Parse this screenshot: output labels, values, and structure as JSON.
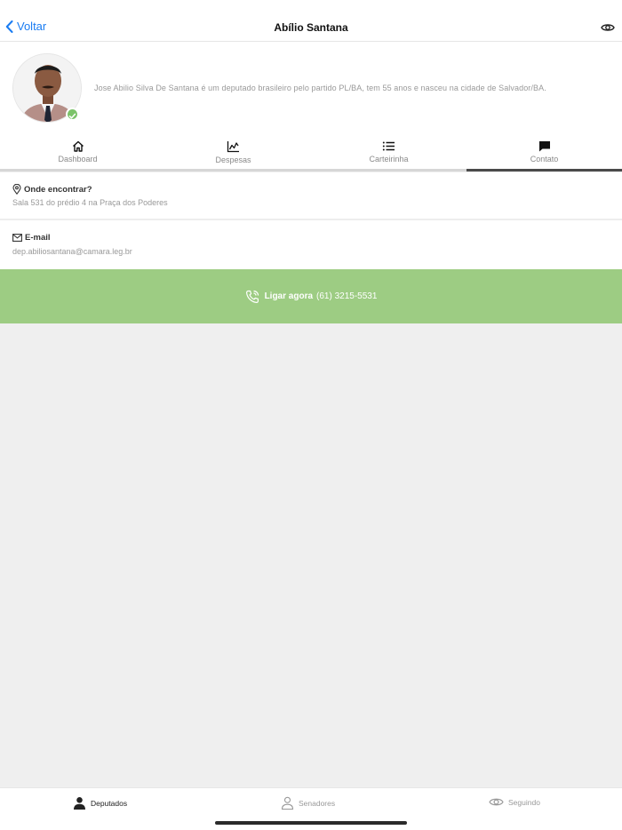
{
  "nav": {
    "back_label": "Voltar",
    "title": "Abílio Santana",
    "eye_icon": "eye-icon"
  },
  "profile": {
    "bio": "Jose Abilio Silva De Santana é um deputado brasileiro pelo partido PL/BA, tem 55 anos e nasceu na cidade de Salvador/BA.",
    "verified_color": "#7cc36a"
  },
  "tabs": [
    {
      "label": "Dashboard",
      "icon": "home-icon",
      "active": false
    },
    {
      "label": "Despesas",
      "icon": "chart-icon",
      "active": false
    },
    {
      "label": "Carteirinha",
      "icon": "list-icon",
      "active": false
    },
    {
      "label": "Contato",
      "icon": "chat-icon",
      "active": true
    }
  ],
  "contact": {
    "location_title": "Onde encontrar?",
    "location_value": "Sala 531 do prédio 4 na Praça dos Poderes",
    "email_title": "E-mail",
    "email_value": "dep.abiliosantana@camara.leg.br"
  },
  "call": {
    "label": "Ligar agora",
    "phone": "(61) 3215-5531",
    "color": "#9dcc83"
  },
  "bottom_tabs": [
    {
      "label": "Deputados",
      "icon": "person-icon",
      "active": true
    },
    {
      "label": "Senadores",
      "icon": "person-outline-icon",
      "active": false
    },
    {
      "label": "Seguindo",
      "icon": "eye-icon",
      "active": false
    }
  ],
  "accent": "#1a7cf2"
}
